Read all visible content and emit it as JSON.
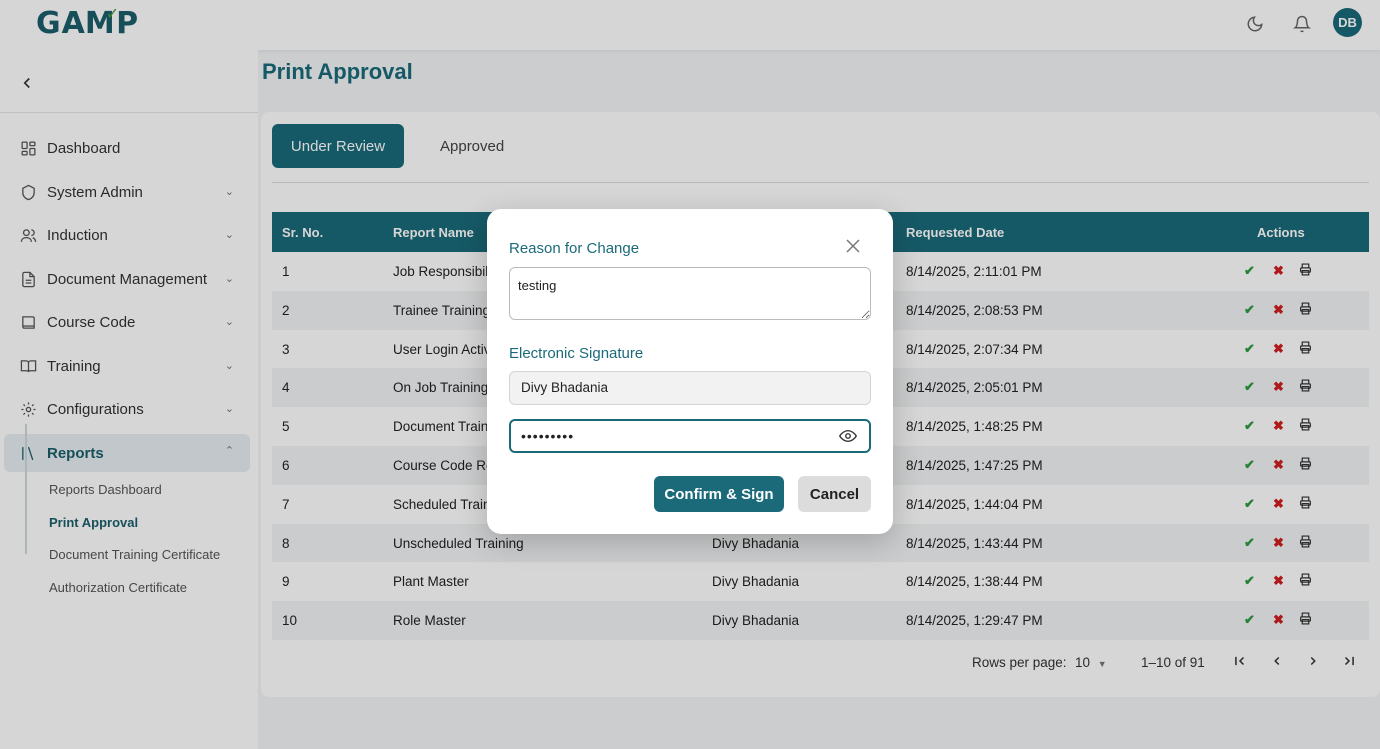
{
  "header": {
    "logo": "GAMP",
    "avatar_initials": "DB",
    "icons": [
      "moon-icon",
      "bell-icon"
    ]
  },
  "sidebar": {
    "items": [
      {
        "label": "Dashboard",
        "icon": "grid-icon"
      },
      {
        "label": "System Admin",
        "icon": "shield-icon"
      },
      {
        "label": "Induction",
        "icon": "users-icon"
      },
      {
        "label": "Document Management",
        "icon": "document-icon"
      },
      {
        "label": "Course Code",
        "icon": "book-icon"
      },
      {
        "label": "Training",
        "icon": "open-book-icon"
      },
      {
        "label": "Configurations",
        "icon": "gear-icon"
      },
      {
        "label": "Reports",
        "icon": "library-icon"
      }
    ],
    "sub_items": [
      {
        "label": "Reports Dashboard"
      },
      {
        "label": "Print Approval"
      },
      {
        "label": "Document Training Certificate"
      },
      {
        "label": "Authorization Certificate"
      }
    ]
  },
  "main": {
    "title": "Print Approval",
    "tabs": [
      {
        "label": "Under Review"
      },
      {
        "label": "Approved"
      }
    ],
    "table": {
      "headers": [
        "Sr. No.",
        "Report Name",
        "Requested Date",
        "Actions"
      ],
      "rows": [
        {
          "sr": "1",
          "name": "Job Responsibili",
          "by": "",
          "date": "8/14/2025, 2:11:01 PM"
        },
        {
          "sr": "2",
          "name": "Trainee Training",
          "by": "",
          "date": "8/14/2025, 2:08:53 PM"
        },
        {
          "sr": "3",
          "name": "User Login Activ",
          "by": "",
          "date": "8/14/2025, 2:07:34 PM"
        },
        {
          "sr": "4",
          "name": "On Job Training",
          "by": "",
          "date": "8/14/2025, 2:05:01 PM"
        },
        {
          "sr": "5",
          "name": "Document Traini",
          "by": "",
          "date": "8/14/2025, 1:48:25 PM"
        },
        {
          "sr": "6",
          "name": "Course Code Re",
          "by": "",
          "date": "8/14/2025, 1:47:25 PM"
        },
        {
          "sr": "7",
          "name": "Scheduled Traini",
          "by": "",
          "date": "8/14/2025, 1:44:04 PM"
        },
        {
          "sr": "8",
          "name": "Unscheduled Training",
          "by": "Divy Bhadania",
          "date": "8/14/2025, 1:43:44 PM"
        },
        {
          "sr": "9",
          "name": "Plant Master",
          "by": "Divy Bhadania",
          "date": "8/14/2025, 1:38:44 PM"
        },
        {
          "sr": "10",
          "name": "Role Master",
          "by": "Divy Bhadania",
          "date": "8/14/2025, 1:29:47 PM"
        }
      ]
    },
    "pagination": {
      "rows_per_page_label": "Rows per page:",
      "rows_per_page_value": "10",
      "range": "1–10 of 91"
    }
  },
  "modal": {
    "reason_label": "Reason for Change",
    "reason_value": "testing",
    "signature_label": "Electronic Signature",
    "user_value": "Divy Bhadania",
    "password_value": "•••••••••",
    "confirm_label": "Confirm & Sign",
    "cancel_label": "Cancel"
  },
  "colors": {
    "primary": "#1b6a7a",
    "approve": "#2e9b3e",
    "reject": "#d02020"
  }
}
